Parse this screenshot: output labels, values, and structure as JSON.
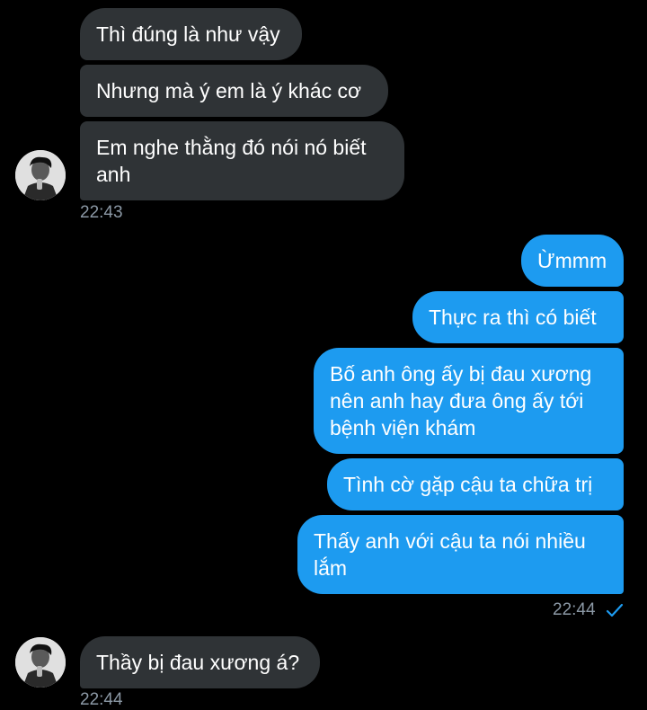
{
  "colors": {
    "incoming_bubble": "#2f3336",
    "outgoing_bubble": "#1d9bf0",
    "timestamp": "#8b98a5",
    "check": "#1d9bf0"
  },
  "messages": [
    {
      "id": "m1",
      "side": "incoming",
      "text": "Thì đúng là như vậy"
    },
    {
      "id": "m2",
      "side": "incoming",
      "text": "Nhưng mà ý em là ý khác cơ"
    },
    {
      "id": "m3",
      "side": "incoming",
      "text": "Em nghe thằng đó nói nó biết\nanh"
    },
    {
      "id": "m4",
      "side": "outgoing",
      "text": "Ừmmm"
    },
    {
      "id": "m5",
      "side": "outgoing",
      "text": "Thực ra thì có biết"
    },
    {
      "id": "m6",
      "side": "outgoing",
      "text": "Bố anh ông ấy bị đau xương\nnên anh hay đưa ông ấy tới\nbệnh viện khám"
    },
    {
      "id": "m7",
      "side": "outgoing",
      "text": "Tình cờ gặp cậu ta chữa trị"
    },
    {
      "id": "m8",
      "side": "outgoing",
      "text": "Thấy anh với cậu ta nói nhiều\nlắm"
    },
    {
      "id": "m9",
      "side": "incoming",
      "text": "Thầy bị đau xương á?"
    }
  ],
  "timestamps": {
    "group1": "22:43",
    "group2": "22:44",
    "group3": "22:44"
  },
  "icons": {
    "avatar": "contact-avatar-icon",
    "read_receipt": "checkmark-icon"
  }
}
